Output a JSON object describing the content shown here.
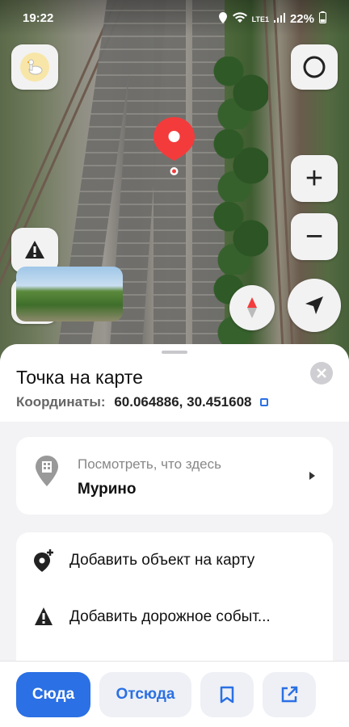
{
  "status_bar": {
    "time": "19:22",
    "battery": "22%",
    "network_label": "LTE1"
  },
  "map": {
    "zoom_in_label": "+",
    "zoom_out_label": "−"
  },
  "sheet": {
    "title": "Точка на карте",
    "coordinates_label": "Координаты:",
    "coordinates_value": "60.064886, 30.451608",
    "whats_here": {
      "subtitle": "Посмотреть, что здесь",
      "place": "Мурино"
    },
    "actions": [
      {
        "label": "Добавить объект на карту"
      },
      {
        "label": "Добавить дорожное событ..."
      }
    ]
  },
  "bottom_bar": {
    "here_label": "Сюда",
    "from_label": "Отсюда"
  },
  "colors": {
    "accent": "#2b70e4",
    "pin_red": "#f43b3b"
  }
}
